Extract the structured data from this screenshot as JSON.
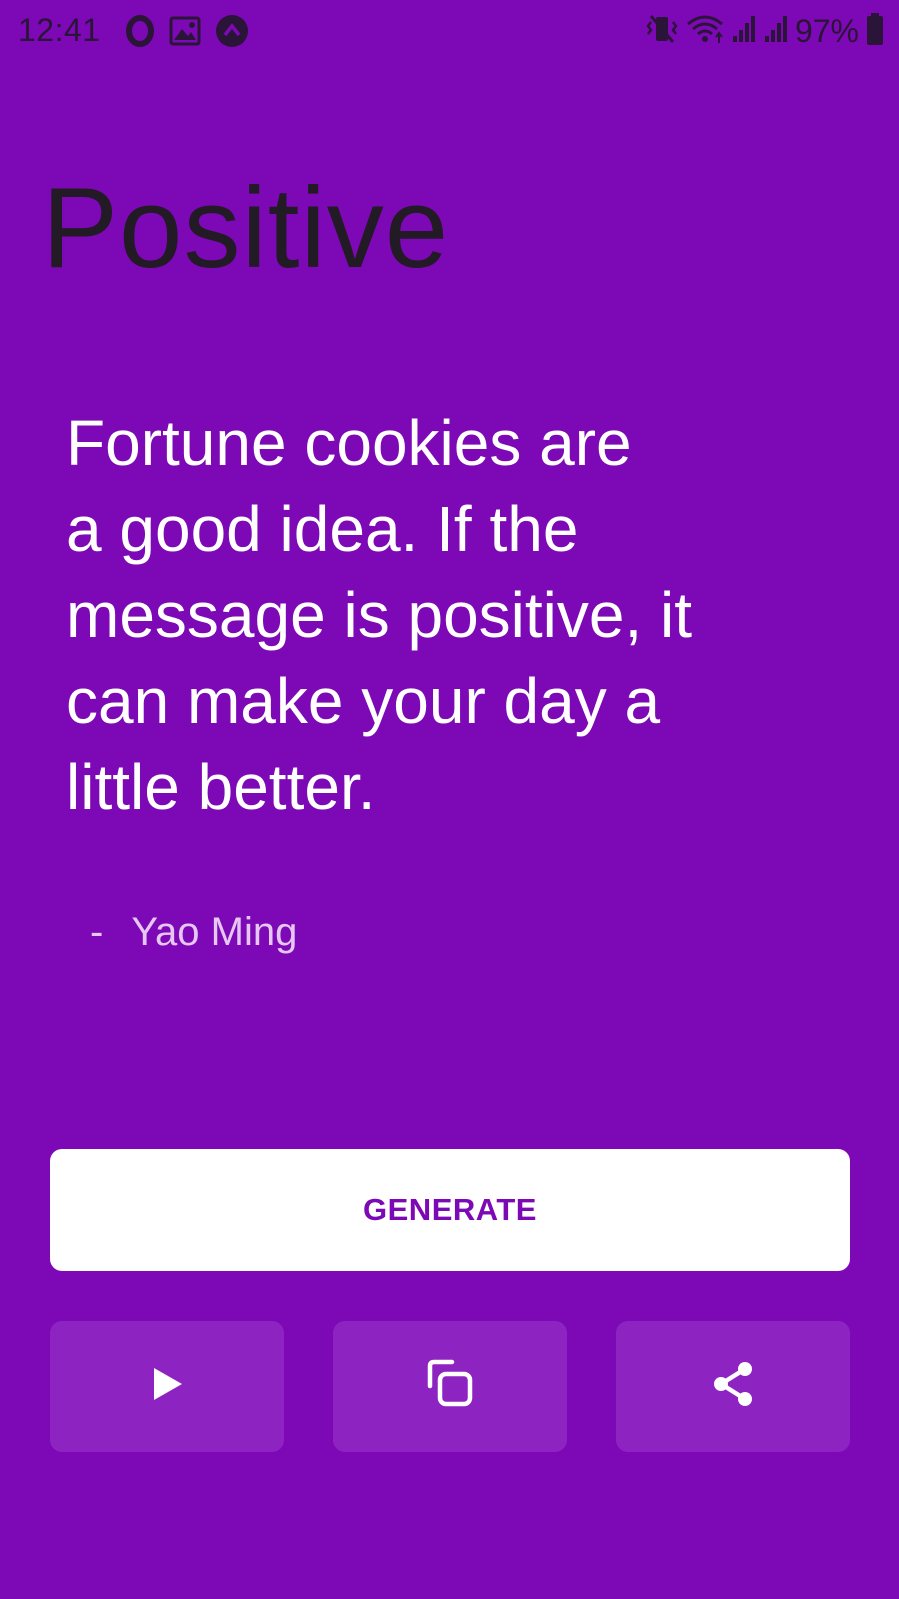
{
  "status_bar": {
    "time": "12:41",
    "battery": "97%",
    "left_icons": [
      "opera-icon",
      "image-icon",
      "arrow-up-badge-icon"
    ],
    "right_icons": [
      "vibrate-icon",
      "wifi-icon",
      "signal-icon",
      "signal-icon",
      "battery-icon"
    ]
  },
  "category": {
    "title": "Positive"
  },
  "quote": {
    "lines": [
      "Fortune cookies are",
      "a good idea. If the",
      "message is positive, it",
      "can make your day a",
      "little better."
    ],
    "author_dash": "-",
    "author": "Yao Ming"
  },
  "actions": {
    "generate_label": "GENERATE",
    "play_icon": "play-icon",
    "copy_icon": "copy-icon",
    "share_icon": "share-icon"
  },
  "colors": {
    "background": "#7d08b5",
    "button_secondary": "#8d24c2",
    "title": "#221a24",
    "quote": "#ffffff",
    "author": "#e6c7f4"
  }
}
